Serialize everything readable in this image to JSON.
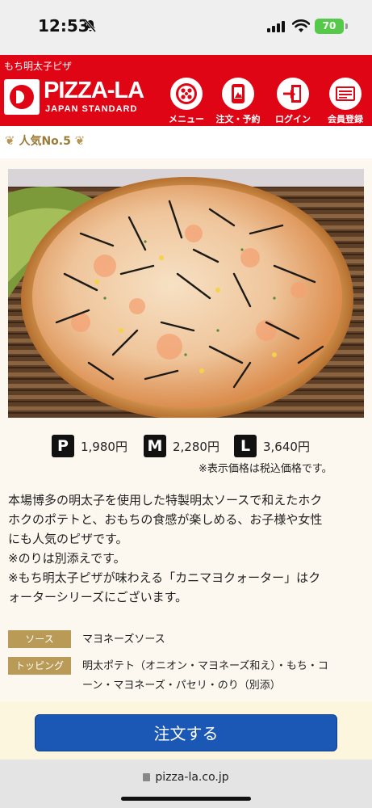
{
  "status": {
    "time": "12:53",
    "battery": "70"
  },
  "header": {
    "page_label": "もち明太子ピザ",
    "logo_text": "PIZZA-LA",
    "logo_sub": "JAPAN STANDARD",
    "nav": [
      {
        "label": "メニュー",
        "icon": "pizza-menu-icon"
      },
      {
        "label": "注文・予約",
        "icon": "phone-order-icon"
      },
      {
        "label": "ログイン",
        "icon": "login-door-icon"
      },
      {
        "label": "会員登録",
        "icon": "member-card-icon"
      }
    ]
  },
  "ranking": {
    "label": "人気No.5"
  },
  "product": {
    "image_alt": "もち明太子ピザ",
    "prices": [
      {
        "size": "P",
        "price": "1,980円"
      },
      {
        "size": "M",
        "price": "2,280円"
      },
      {
        "size": "L",
        "price": "3,640円"
      }
    ],
    "tax_note": "※表示価格は税込価格です。",
    "description": [
      "本場博多の明太子を使用した特製明太ソースで和えたホク",
      "ホクのポテトと、おもちの食感が楽しめる、お子様や女性",
      "にも人気のピザです。",
      "※のりは別添えです。",
      "※もち明太子ピザが味わえる「カニマヨクォーター」はク",
      "ォーターシリーズにございます。"
    ],
    "specs": [
      {
        "label": "ソース",
        "value_lines": [
          "マヨネーズソース"
        ]
      },
      {
        "label": "トッピング",
        "value_lines": [
          "明太ポテト（オニオン・マヨネーズ和え）・もち・コ",
          "ーン・マヨネーズ・パセリ・のり（別添）"
        ]
      }
    ]
  },
  "order": {
    "button_label": "注文する"
  },
  "browser": {
    "url": "pizza-la.co.jp"
  },
  "colors": {
    "brand_red": "#e00514",
    "order_blue": "#1b58b6",
    "label_gold": "#b99a57"
  }
}
